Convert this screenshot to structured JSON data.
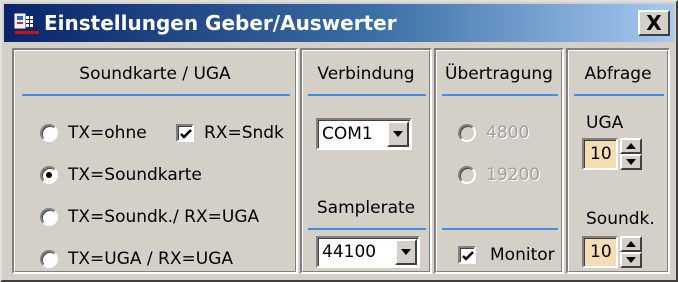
{
  "window": {
    "title": "Einstellungen Geber/Auswerter",
    "close_label": "X",
    "title_gradient": [
      "#0a246a",
      "#a6caf0"
    ]
  },
  "soundkarte": {
    "header": "Soundkarte / UGA",
    "options": [
      {
        "label": "TX=ohne",
        "checked": false
      },
      {
        "label": "TX=Soundkarte",
        "checked": true
      },
      {
        "label": "TX=Soundk./ RX=UGA",
        "checked": false
      },
      {
        "label": "TX=UGA / RX=UGA",
        "checked": false
      }
    ],
    "rx_checkbox": {
      "label": "RX=Sndk",
      "checked": true
    }
  },
  "verbindung": {
    "header": "Verbindung",
    "port_value": "COM1",
    "samplerate_header": "Samplerate",
    "samplerate_value": "44100"
  },
  "uebertragung": {
    "header": "Übertragung",
    "options": [
      {
        "label": "4800",
        "enabled": false
      },
      {
        "label": "19200",
        "enabled": false
      }
    ],
    "monitor": {
      "label": "Monitor",
      "checked": true
    }
  },
  "abfrage": {
    "header": "Abfrage",
    "uga_label": "UGA",
    "uga_value": "10",
    "soundk_label": "Soundk.",
    "soundk_value": "10"
  },
  "colors": {
    "accent_line": "#3c8ee6",
    "spin_bg": "#f5deb3",
    "face": "#d4d0c8"
  }
}
